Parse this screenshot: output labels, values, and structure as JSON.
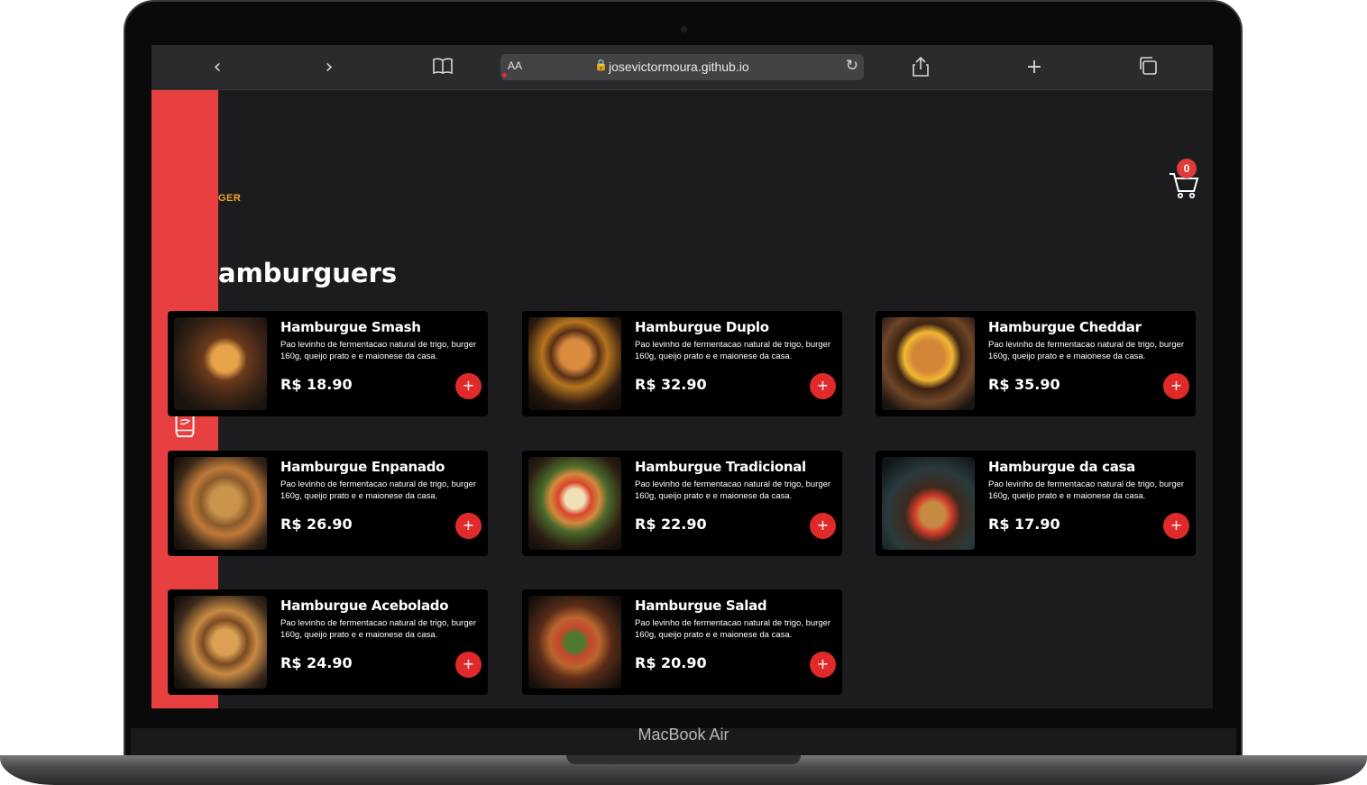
{
  "browser": {
    "url_prefix": "AA",
    "url": "josevictormoura.github.io"
  },
  "device": {
    "label": "MacBook Air"
  },
  "header": {
    "logo_text": "GER",
    "cart_count": "0"
  },
  "section": {
    "title": "amburguers"
  },
  "products": [
    {
      "name": "Hamburgue Smash",
      "desc": "Pao levinho de fermentacao natural de trigo, burger 160g, queijo prato e e maionese da casa.",
      "price": "R$ 18.90",
      "add": "+"
    },
    {
      "name": "Hamburgue Duplo",
      "desc": "Pao levinho de fermentacao natural de trigo, burger 160g, queijo prato e e maionese da casa.",
      "price": "R$ 32.90",
      "add": "+"
    },
    {
      "name": "Hamburgue Cheddar",
      "desc": "Pao levinho de fermentacao natural de trigo, burger 160g, queijo prato e e maionese da casa.",
      "price": "R$ 35.90",
      "add": "+"
    },
    {
      "name": "Hamburgue Enpanado",
      "desc": "Pao levinho de fermentacao natural de trigo, burger 160g, queijo prato e e maionese da casa.",
      "price": "R$ 26.90",
      "add": "+"
    },
    {
      "name": "Hamburgue Tradicional",
      "desc": "Pao levinho de fermentacao natural de trigo, burger 160g, queijo prato e e maionese da casa.",
      "price": "R$ 22.90",
      "add": "+"
    },
    {
      "name": "Hamburgue da casa",
      "desc": "Pao levinho de fermentacao natural de trigo, burger 160g, queijo prato e e maionese da casa.",
      "price": "R$ 17.90",
      "add": "+"
    },
    {
      "name": "Hamburgue Acebolado",
      "desc": "Pao levinho de fermentacao natural de trigo, burger 160g, queijo prato e e maionese da casa.",
      "price": "R$ 24.90",
      "add": "+"
    },
    {
      "name": "Hamburgue Salad",
      "desc": "Pao levinho de fermentacao natural de trigo, burger 160g, queijo prato e e maionese da casa.",
      "price": "R$ 20.90",
      "add": "+"
    }
  ],
  "sidebar_icons": [
    "burger-icon",
    "pizza-icon",
    "soda-can-icon",
    "dessert-icon"
  ],
  "colors": {
    "accent": "#e84040",
    "button": "#e02a2a",
    "logo": "#f4a52b",
    "background": "#1c1c1e"
  }
}
